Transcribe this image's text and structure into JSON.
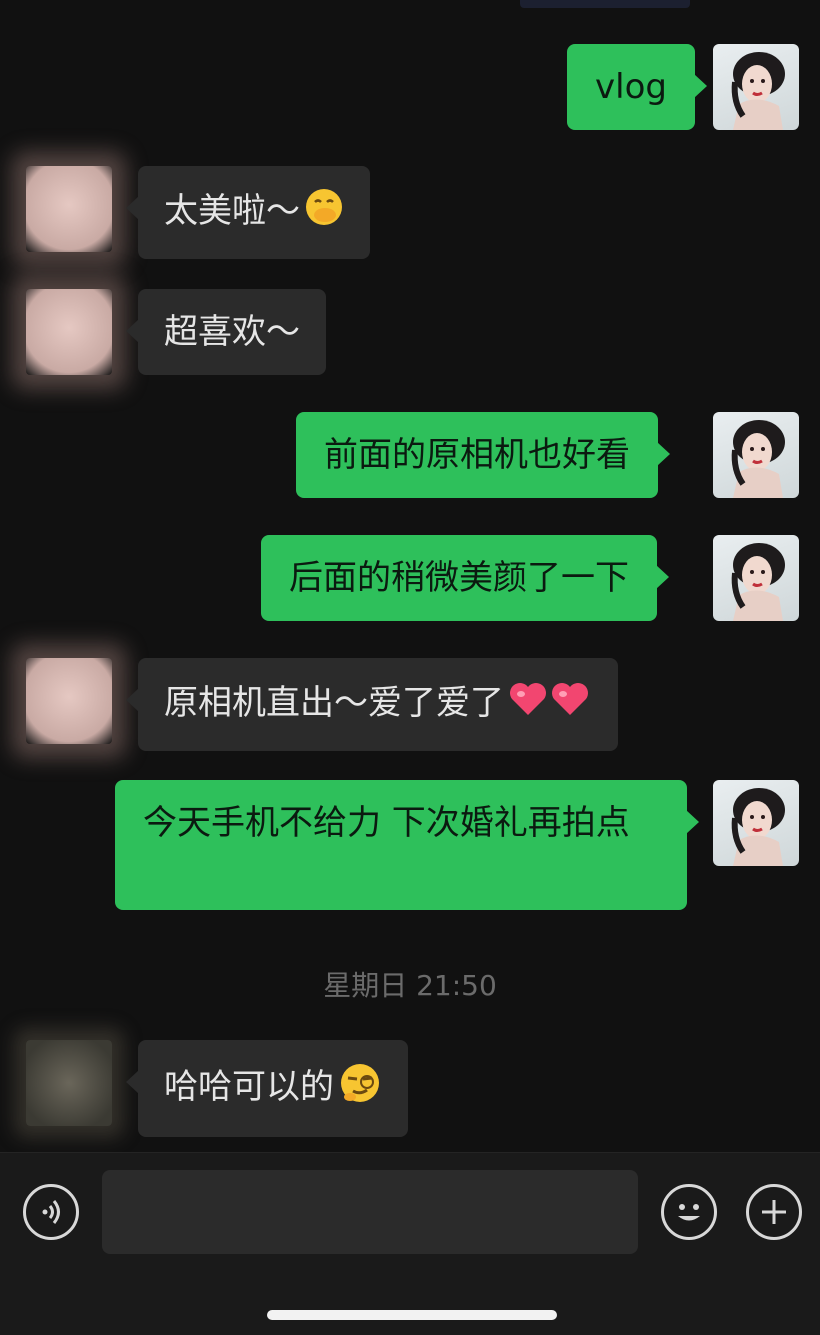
{
  "messages": [
    {
      "side": "right",
      "text": "vlog"
    },
    {
      "side": "left",
      "text": "太美啦～",
      "emoji": "face-with-hand-over-mouth"
    },
    {
      "side": "left",
      "text": "超喜欢～"
    },
    {
      "side": "right",
      "text": "前面的原相机也好看"
    },
    {
      "side": "right",
      "text": "后面的稍微美颜了一下"
    },
    {
      "side": "left",
      "text": "原相机直出～爱了爱了",
      "emoji": "two-red-hearts"
    },
    {
      "side": "right",
      "text": "今天手机不给力 下次婚礼再拍点"
    },
    {
      "side": "left",
      "text": "哈哈可以的",
      "emoji": "smirking-face-with-monocle"
    }
  ],
  "timestamp": "星期日 21:50",
  "input_bar": {
    "placeholder": "",
    "left_icon": "voice-icon",
    "emoji_icon": "emoji-smile-icon",
    "plus_icon": "plus-icon"
  },
  "colors": {
    "background": "#111111",
    "bubble_self": "#2ec05b",
    "bubble_other": "#2b2b2b",
    "timestamp": "#6b6b6b"
  }
}
